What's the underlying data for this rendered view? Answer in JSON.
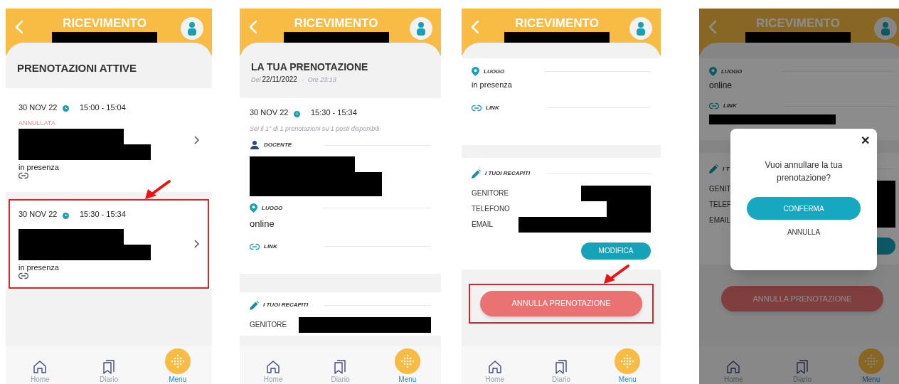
{
  "screens": [
    {
      "kind": "list",
      "header": {
        "title": "RICEVIMENTO"
      },
      "section_title": "PRENOTAZIONI ATTIVE",
      "bookings": [
        {
          "date": "30 NOV 22",
          "time": "15:00 - 15:04",
          "status": "ANNULLATA",
          "place": "in presenza",
          "highlighted": false
        },
        {
          "date": "30 NOV 22",
          "time": "15:30 - 15:34",
          "place": "in presenza",
          "highlighted": true
        }
      ],
      "nav": [
        {
          "kind": "home",
          "label": "Home",
          "selected": false
        },
        {
          "kind": "diary",
          "label": "Diario",
          "selected": false
        },
        {
          "kind": "menu",
          "label": "Menu",
          "selected": true
        }
      ]
    },
    {
      "kind": "detail",
      "header": {
        "title": "RICEVIMENTO"
      },
      "title": "LA TUA PRENOTAZIONE",
      "subtitle": {
        "prefix": "Del",
        "date": "22/11/2022",
        "separator": "-",
        "time": "Ore 23:13"
      },
      "slot": {
        "date": "30 NOV 22",
        "time": "15:30 - 15:34"
      },
      "note": "Sei il 1° di 1 prenotazioni su 1 posti disponibili",
      "sections": [
        {
          "kind": "teacher",
          "label": "DOCENTE"
        },
        {
          "kind": "place",
          "label": "LUOGO",
          "value": "online"
        },
        {
          "kind": "link",
          "label": "LINK",
          "redacted": false
        },
        {
          "kind": "contacts",
          "label": "I TUOI RECAPITI",
          "rows": [
            "GENITORE"
          ]
        }
      ],
      "nav": [
        {
          "kind": "home",
          "label": "Home",
          "selected": false
        },
        {
          "kind": "diary",
          "label": "Diario",
          "selected": false
        },
        {
          "kind": "menu",
          "label": "Menu",
          "selected": true
        }
      ]
    },
    {
      "kind": "detail",
      "header": {
        "title": "RICEVIMENTO"
      },
      "sections": [
        {
          "kind": "place",
          "label": "LUOGO",
          "value": "in presenza"
        },
        {
          "kind": "link",
          "label": "LINK",
          "redacted": false
        },
        {
          "kind": "contacts",
          "label": "I TUOI RECAPITI",
          "rows": [
            "GENITORE",
            "TELEFONO",
            "EMAIL"
          ],
          "edit_button": {
            "label": "MODIFICA"
          }
        }
      ],
      "cancel_button": {
        "label": "ANNULLA PRENOTAZIONE",
        "highlighted": true
      },
      "nav": [
        {
          "kind": "home",
          "label": "Home",
          "selected": false
        },
        {
          "kind": "diary",
          "label": "Diario",
          "selected": false
        },
        {
          "kind": "menu",
          "label": "Menu",
          "selected": true
        }
      ]
    },
    {
      "kind": "detail",
      "header": {
        "title": "RICEVIMENTO"
      },
      "dimmed": true,
      "sections": [
        {
          "kind": "place",
          "label": "LUOGO",
          "value": "online"
        },
        {
          "kind": "link",
          "label": "LINK",
          "redacted": true
        },
        {
          "kind": "contacts",
          "label": "I T",
          "rows": [
            "GENIT",
            "TELEF",
            "EMAIL"
          ],
          "edit_button": true
        }
      ],
      "cancel_button": {
        "label": "ANNULLA PRENOTAZIONE",
        "highlighted": false
      },
      "dialog": {
        "close": "✕",
        "message": "Vuoi annullare la tua prenotazione?",
        "confirm": "CONFERMA",
        "cancel": "ANNULLA"
      },
      "nav": [
        {
          "kind": "home",
          "label": "Home",
          "selected": false
        },
        {
          "kind": "diary",
          "label": "Diario",
          "selected": false
        },
        {
          "kind": "menu",
          "label": "Menu",
          "selected": true
        }
      ]
    }
  ]
}
